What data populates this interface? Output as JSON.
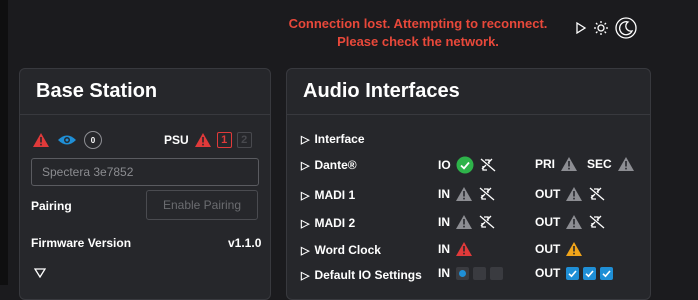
{
  "alert": {
    "line1": "Connection lost. Attempting to reconnect.",
    "line2": "Please check the network."
  },
  "top_icons": [
    "play-icon",
    "brightness-icon",
    "dark-mode-icon"
  ],
  "base_station": {
    "title": "Base Station",
    "status_badge": "0",
    "psu_label": "PSU",
    "psu_slot_1": "1",
    "psu_slot_2": "2",
    "device_name": "Spectera 3e7852",
    "pairing_label": "Pairing",
    "pairing_button": "Enable Pairing",
    "firmware_label": "Firmware Version",
    "firmware_value": "v1.1.0"
  },
  "audio": {
    "title": "Audio Interfaces",
    "header": "Interface",
    "rows": [
      {
        "name": "Dante®",
        "left_label": "IO",
        "right1_label": "PRI",
        "right2_label": "SEC"
      },
      {
        "name": "MADI 1",
        "left_label": "IN",
        "right1_label": "OUT"
      },
      {
        "name": "MADI 2",
        "left_label": "IN",
        "right1_label": "OUT"
      },
      {
        "name": "Word Clock",
        "left_label": "IN",
        "right1_label": "OUT"
      },
      {
        "name": "Default IO Settings",
        "left_label": "IN",
        "right1_label": "OUT"
      }
    ]
  },
  "colors": {
    "alert": "#e8483a",
    "error": "#e03a3a",
    "ok": "#2eb34a",
    "warning": "#f2a51a",
    "info": "#1f8fd6",
    "muted": "#8d8e93"
  }
}
